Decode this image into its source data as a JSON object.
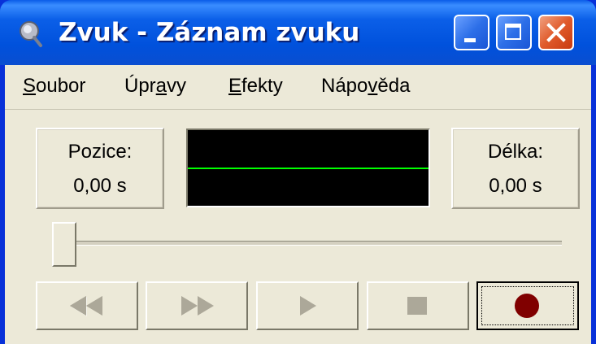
{
  "window": {
    "title": "Zvuk - Záznam zvuku"
  },
  "menu": [
    {
      "label": "Soubor",
      "access_key": "S"
    },
    {
      "label": "Úpravy",
      "access_key": "a"
    },
    {
      "label": "Efekty",
      "access_key": "E"
    },
    {
      "label": "Nápověda",
      "access_key": "v"
    }
  ],
  "position": {
    "label": "Pozice:",
    "value": "0,00 s"
  },
  "length": {
    "label": "Délka:",
    "value": "0,00 s"
  },
  "seek": {
    "value": 0
  },
  "buttons": {
    "rewind": {
      "icon": "rewind-icon",
      "enabled": false
    },
    "fast_forward": {
      "icon": "fast-forward-icon",
      "enabled": false
    },
    "play": {
      "icon": "play-icon",
      "enabled": false
    },
    "stop": {
      "icon": "stop-icon",
      "enabled": false
    },
    "record": {
      "icon": "record-icon",
      "enabled": true
    }
  },
  "colors": {
    "titlebar": "#0054e3",
    "waveform_bg": "#000000",
    "waveform_line": "#00ff00",
    "record_dot": "#800000",
    "disabled_glyph": "#aca899"
  }
}
